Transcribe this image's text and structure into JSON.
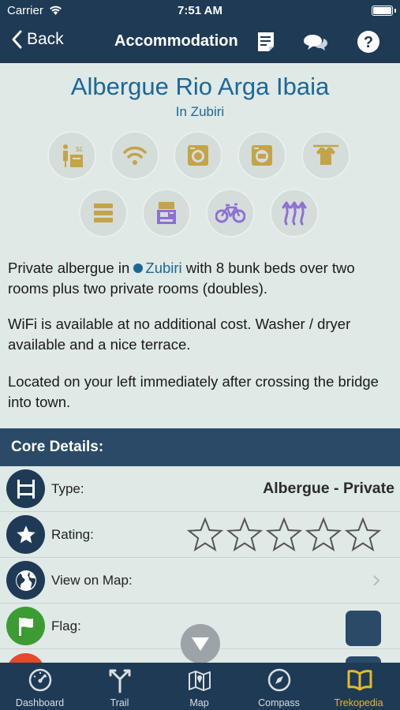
{
  "status_bar": {
    "carrier": "Carrier",
    "time": "7:51 AM"
  },
  "nav": {
    "back_label": "Back",
    "title": "Accommodation"
  },
  "header": {
    "name": "Albergue Rio Arga Ibaia",
    "town": "In Zubiri"
  },
  "amenities": [
    {
      "icon": "reception-icon"
    },
    {
      "icon": "wifi-icon"
    },
    {
      "icon": "washer-icon"
    },
    {
      "icon": "dryer-icon"
    },
    {
      "icon": "clothesline-icon"
    },
    {
      "icon": "lockers-icon"
    },
    {
      "icon": "vending-icon"
    },
    {
      "icon": "bicycle-icon"
    },
    {
      "icon": "heating-icon"
    }
  ],
  "description": {
    "p1_before": "Private albergue in ",
    "p1_link": "Zubiri",
    "p1_after": " with 8 bunk beds over two rooms plus two private rooms (doubles).",
    "p2": "WiFi is available at no additional cost. Washer / dryer available and a nice terrace.",
    "p3": "Located on your left immediately after crossing the bridge into town."
  },
  "core_details": {
    "header": "Core Details:",
    "type_label": "Type:",
    "type_value": "Albergue - Private",
    "rating_label": "Rating:",
    "rating_value": 0,
    "rating_max": 5,
    "map_label": "View on Map:",
    "flag_label": "Flag:"
  },
  "tabs": [
    {
      "label": "Dashboard",
      "icon": "speedometer-icon"
    },
    {
      "label": "Trail",
      "icon": "trail-signpost-icon"
    },
    {
      "label": "Map",
      "icon": "map-icon"
    },
    {
      "label": "Compass",
      "icon": "compass-icon"
    },
    {
      "label": "Trekopedia",
      "icon": "book-icon",
      "active": true
    }
  ],
  "colors": {
    "nav_bg": "#1f3a55",
    "page_bg": "#dfe9e6",
    "link": "#1d6796",
    "amenity_gold": "#c5a347",
    "amenity_purple": "#8e6fd4",
    "active_tab": "#e3bb2a"
  }
}
